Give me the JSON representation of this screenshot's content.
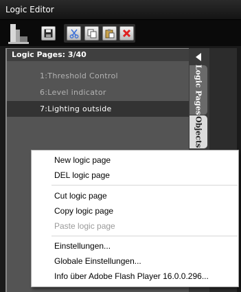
{
  "window": {
    "title": "Logic Editor"
  },
  "toolbar": {
    "buttons": [
      {
        "name": "save",
        "icon": "floppy-disk-icon"
      },
      {
        "name": "cut",
        "icon": "scissors-icon"
      },
      {
        "name": "copy",
        "icon": "copy-icon"
      },
      {
        "name": "paste",
        "icon": "paste-icon"
      },
      {
        "name": "delete",
        "icon": "red-x-icon"
      }
    ]
  },
  "pages_panel": {
    "header": "Logic Pages: 3/40",
    "items": [
      {
        "label": "1:Threshold Control",
        "selected": false
      },
      {
        "label": "6:Level indicator",
        "selected": false
      },
      {
        "label": "7:Lighting outside",
        "selected": true
      }
    ]
  },
  "sidebar": {
    "tabs": [
      {
        "label": "Logic Pages",
        "active": true
      },
      {
        "label": "Objects",
        "active": false
      }
    ]
  },
  "context_menu": {
    "groups": [
      [
        {
          "label": "New logic page",
          "enabled": true
        },
        {
          "label": "DEL logic page",
          "enabled": true
        }
      ],
      [
        {
          "label": "Cut logic page",
          "enabled": true
        },
        {
          "label": "Copy logic page",
          "enabled": true
        },
        {
          "label": "Paste logic page",
          "enabled": false
        }
      ],
      [
        {
          "label": "Einstellungen...",
          "enabled": true
        },
        {
          "label": "Globale Einstellungen...",
          "enabled": true
        },
        {
          "label": "Info über Adobe Flash Player 16.0.0.296...",
          "enabled": true
        }
      ]
    ]
  },
  "colors": {
    "background": "#1a1a1a",
    "panel": "#545454",
    "selected_row": "#333333",
    "disabled_text": "#9a9a9a",
    "delete_icon": "#e02020"
  }
}
